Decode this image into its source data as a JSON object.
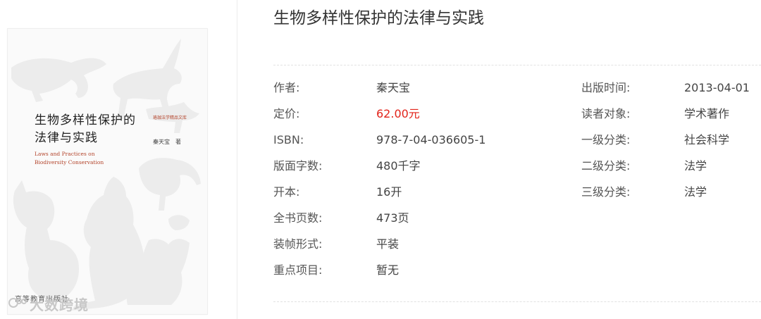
{
  "book": {
    "title": "生物多样性保护的法律与实践",
    "cover": {
      "title_line1": "生物多样性保护的",
      "title_line2": "法律与实践",
      "series": "珞珈法学精品文库",
      "author": "秦天宝　著",
      "english_line1": "Laws and Practices on",
      "english_line2": "Biodiversity Conservation",
      "publisher": "高等教育出版社"
    }
  },
  "details_left": [
    {
      "label": "作者:",
      "value": "秦天宝"
    },
    {
      "label": "定价:",
      "value": "62.00元"
    },
    {
      "label": "ISBN:",
      "value": "978-7-04-036605-1"
    },
    {
      "label": "版面字数:",
      "value": "480千字"
    },
    {
      "label": "开本:",
      "value": "16开"
    },
    {
      "label": "全书页数:",
      "value": "473页"
    },
    {
      "label": "装帧形式:",
      "value": "平装"
    },
    {
      "label": "重点项目:",
      "value": "暂无"
    }
  ],
  "details_right": [
    {
      "label": "出版时间:",
      "value": "2013-04-01"
    },
    {
      "label": "读者对象:",
      "value": "学术著作"
    },
    {
      "label": "一级分类:",
      "value": "社会科学"
    },
    {
      "label": "二级分类:",
      "value": "法学"
    },
    {
      "label": "三级分类:",
      "value": "法学"
    }
  ],
  "watermark": {
    "text": "大数跨境",
    "icon": "chat-bubble-icon"
  },
  "colors": {
    "price": "#e2231a",
    "cover_accent": "#b3442b",
    "silhouette": "#ececec"
  }
}
